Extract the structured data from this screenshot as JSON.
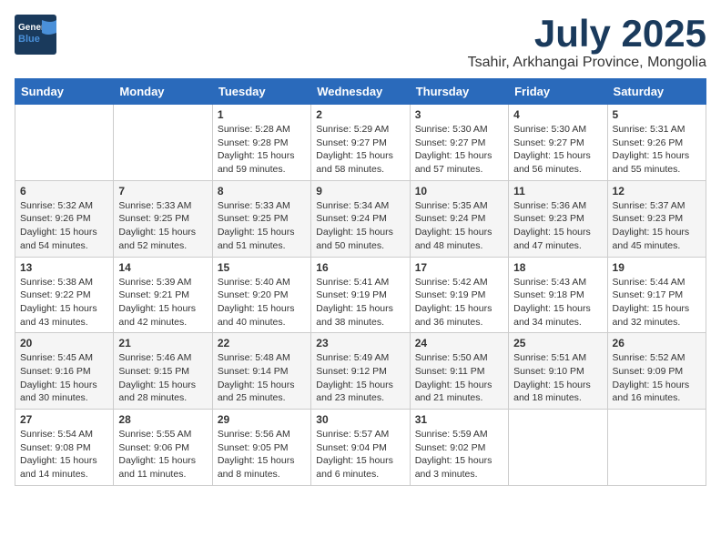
{
  "logo": {
    "line1": "General",
    "line2": "Blue"
  },
  "title": "July 2025",
  "subtitle": "Tsahir, Arkhangai Province, Mongolia",
  "weekdays": [
    "Sunday",
    "Monday",
    "Tuesday",
    "Wednesday",
    "Thursday",
    "Friday",
    "Saturday"
  ],
  "weeks": [
    [
      {
        "day": "",
        "info": ""
      },
      {
        "day": "",
        "info": ""
      },
      {
        "day": "1",
        "info": "Sunrise: 5:28 AM\nSunset: 9:28 PM\nDaylight: 15 hours\nand 59 minutes."
      },
      {
        "day": "2",
        "info": "Sunrise: 5:29 AM\nSunset: 9:27 PM\nDaylight: 15 hours\nand 58 minutes."
      },
      {
        "day": "3",
        "info": "Sunrise: 5:30 AM\nSunset: 9:27 PM\nDaylight: 15 hours\nand 57 minutes."
      },
      {
        "day": "4",
        "info": "Sunrise: 5:30 AM\nSunset: 9:27 PM\nDaylight: 15 hours\nand 56 minutes."
      },
      {
        "day": "5",
        "info": "Sunrise: 5:31 AM\nSunset: 9:26 PM\nDaylight: 15 hours\nand 55 minutes."
      }
    ],
    [
      {
        "day": "6",
        "info": "Sunrise: 5:32 AM\nSunset: 9:26 PM\nDaylight: 15 hours\nand 54 minutes."
      },
      {
        "day": "7",
        "info": "Sunrise: 5:33 AM\nSunset: 9:25 PM\nDaylight: 15 hours\nand 52 minutes."
      },
      {
        "day": "8",
        "info": "Sunrise: 5:33 AM\nSunset: 9:25 PM\nDaylight: 15 hours\nand 51 minutes."
      },
      {
        "day": "9",
        "info": "Sunrise: 5:34 AM\nSunset: 9:24 PM\nDaylight: 15 hours\nand 50 minutes."
      },
      {
        "day": "10",
        "info": "Sunrise: 5:35 AM\nSunset: 9:24 PM\nDaylight: 15 hours\nand 48 minutes."
      },
      {
        "day": "11",
        "info": "Sunrise: 5:36 AM\nSunset: 9:23 PM\nDaylight: 15 hours\nand 47 minutes."
      },
      {
        "day": "12",
        "info": "Sunrise: 5:37 AM\nSunset: 9:23 PM\nDaylight: 15 hours\nand 45 minutes."
      }
    ],
    [
      {
        "day": "13",
        "info": "Sunrise: 5:38 AM\nSunset: 9:22 PM\nDaylight: 15 hours\nand 43 minutes."
      },
      {
        "day": "14",
        "info": "Sunrise: 5:39 AM\nSunset: 9:21 PM\nDaylight: 15 hours\nand 42 minutes."
      },
      {
        "day": "15",
        "info": "Sunrise: 5:40 AM\nSunset: 9:20 PM\nDaylight: 15 hours\nand 40 minutes."
      },
      {
        "day": "16",
        "info": "Sunrise: 5:41 AM\nSunset: 9:19 PM\nDaylight: 15 hours\nand 38 minutes."
      },
      {
        "day": "17",
        "info": "Sunrise: 5:42 AM\nSunset: 9:19 PM\nDaylight: 15 hours\nand 36 minutes."
      },
      {
        "day": "18",
        "info": "Sunrise: 5:43 AM\nSunset: 9:18 PM\nDaylight: 15 hours\nand 34 minutes."
      },
      {
        "day": "19",
        "info": "Sunrise: 5:44 AM\nSunset: 9:17 PM\nDaylight: 15 hours\nand 32 minutes."
      }
    ],
    [
      {
        "day": "20",
        "info": "Sunrise: 5:45 AM\nSunset: 9:16 PM\nDaylight: 15 hours\nand 30 minutes."
      },
      {
        "day": "21",
        "info": "Sunrise: 5:46 AM\nSunset: 9:15 PM\nDaylight: 15 hours\nand 28 minutes."
      },
      {
        "day": "22",
        "info": "Sunrise: 5:48 AM\nSunset: 9:14 PM\nDaylight: 15 hours\nand 25 minutes."
      },
      {
        "day": "23",
        "info": "Sunrise: 5:49 AM\nSunset: 9:12 PM\nDaylight: 15 hours\nand 23 minutes."
      },
      {
        "day": "24",
        "info": "Sunrise: 5:50 AM\nSunset: 9:11 PM\nDaylight: 15 hours\nand 21 minutes."
      },
      {
        "day": "25",
        "info": "Sunrise: 5:51 AM\nSunset: 9:10 PM\nDaylight: 15 hours\nand 18 minutes."
      },
      {
        "day": "26",
        "info": "Sunrise: 5:52 AM\nSunset: 9:09 PM\nDaylight: 15 hours\nand 16 minutes."
      }
    ],
    [
      {
        "day": "27",
        "info": "Sunrise: 5:54 AM\nSunset: 9:08 PM\nDaylight: 15 hours\nand 14 minutes."
      },
      {
        "day": "28",
        "info": "Sunrise: 5:55 AM\nSunset: 9:06 PM\nDaylight: 15 hours\nand 11 minutes."
      },
      {
        "day": "29",
        "info": "Sunrise: 5:56 AM\nSunset: 9:05 PM\nDaylight: 15 hours\nand 8 minutes."
      },
      {
        "day": "30",
        "info": "Sunrise: 5:57 AM\nSunset: 9:04 PM\nDaylight: 15 hours\nand 6 minutes."
      },
      {
        "day": "31",
        "info": "Sunrise: 5:59 AM\nSunset: 9:02 PM\nDaylight: 15 hours\nand 3 minutes."
      },
      {
        "day": "",
        "info": ""
      },
      {
        "day": "",
        "info": ""
      }
    ]
  ]
}
